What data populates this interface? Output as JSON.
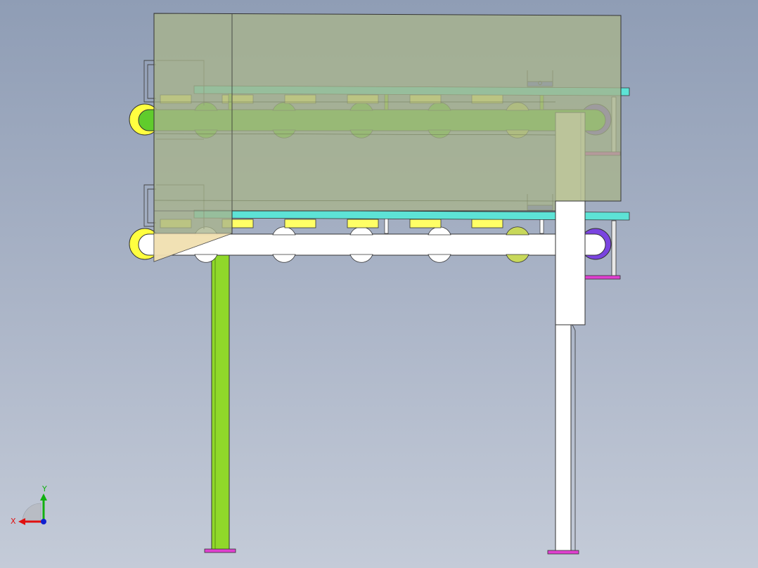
{
  "viewer": {
    "background_top": "#8f9db5",
    "background_bottom": "#c4cbd8"
  },
  "triad": {
    "x_label": "X",
    "y_label": "Y",
    "x_color": "#e01010",
    "y_color": "#10b010",
    "z_color": "#1020d0"
  },
  "model_colors": {
    "housing": "#a8b48c",
    "upper_belt": "#60cc2c",
    "lower_belt": "#ffffff",
    "cyan_rail": "#5de3d6",
    "yellow_pad": "#ffff66",
    "pulley_left": "#ffff40",
    "pulley_right": "#7a44e0",
    "left_leg": "#90d82a",
    "right_column_upper": "#ffffcc",
    "foot_plate": "#e040d0"
  }
}
